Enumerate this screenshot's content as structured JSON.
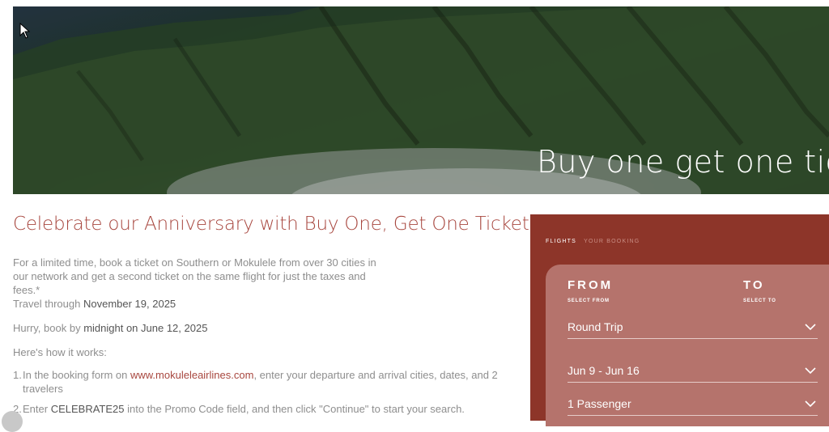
{
  "hero": {
    "title": "Buy one get one ticke"
  },
  "headline": "Celebrate our Anniversary with Buy One, Get One Ticket!",
  "intro": {
    "text": "For a limited time, book a ticket on Southern or Mokulele from over 30 cities in our network and get a second ticket on the same flight for just the taxes and fees.*",
    "travel_prefix": "Travel through",
    "travel_date": "November 19, 2025"
  },
  "deadline": {
    "prefix": "Hurry, book by",
    "time": "midnight on June 12, 2025"
  },
  "how_it_works": "Here's how it works:",
  "steps": [
    {
      "num": "1.",
      "before": "In the booking form on",
      "link": "www.mokuleleairlines.com",
      "after": ", enter your departure and arrival cities, dates, and 2 travelers"
    },
    {
      "num": "2.",
      "before": "Enter",
      "code": "CELEBRATE25",
      "after": "into the Promo Code field, and then click \"Continue\" to start your search."
    }
  ],
  "booking": {
    "tab_active": "FLIGHTS",
    "tab_other": "YOUR BOOKING",
    "from_label": "FROM",
    "from_sub": "SELECT FROM",
    "to_label": "TO",
    "to_sub": "SELECT TO",
    "trip_type": "Round Trip",
    "dates": "Jun 9 - Jun 16",
    "passengers": "1 Passenger"
  },
  "colors": {
    "accent": "#a8473f",
    "booking_bg": "#8d3529",
    "panel_bg": "#b5736c"
  },
  "icons": [
    "cursor-icon",
    "chevron-down-icon",
    "help-icon"
  ]
}
